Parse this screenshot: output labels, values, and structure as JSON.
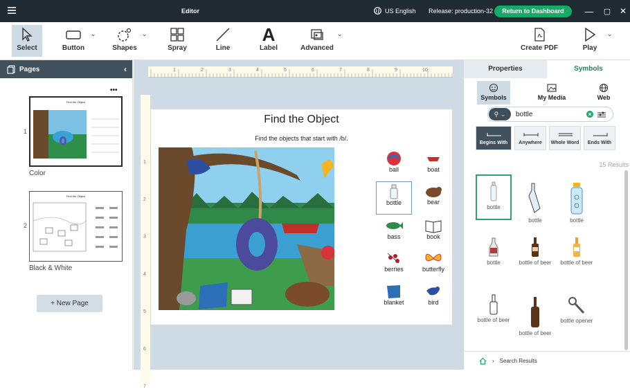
{
  "window": {
    "title": "Editor",
    "language": "US English",
    "release": "Release: production-32",
    "dashboard_button": "Return to Dashboard",
    "minimize": "—",
    "maximize": "▢",
    "close": "✕"
  },
  "toolbar": {
    "tools": [
      {
        "label": "Select",
        "icon": "cursor-icon"
      },
      {
        "label": "Button",
        "icon": "button-icon"
      },
      {
        "label": "Shapes",
        "icon": "shapes-icon"
      },
      {
        "label": "Spray",
        "icon": "spray-icon"
      },
      {
        "label": "Line",
        "icon": "line-icon"
      },
      {
        "label": "Label",
        "icon": "label-icon"
      },
      {
        "label": "Advanced",
        "icon": "advanced-icon"
      },
      {
        "label": "Create PDF",
        "icon": "pdf-icon"
      },
      {
        "label": "Play",
        "icon": "play-icon"
      }
    ]
  },
  "pages_panel": {
    "title": "Pages",
    "more": "•••",
    "pages": [
      {
        "number": "1",
        "label": "Color"
      },
      {
        "number": "2",
        "label": "Black & White"
      }
    ],
    "new_page": "+ New Page"
  },
  "ruler": {
    "marks": [
      "1",
      "2",
      "3",
      "4",
      "5",
      "6",
      "7",
      "8",
      "9",
      "10"
    ],
    "vmarks": [
      "1",
      "2",
      "3",
      "4",
      "5",
      "6",
      "7"
    ]
  },
  "page": {
    "title": "Find the Object",
    "subtitle": "Find the objects that start with /b/.",
    "objects": [
      "ball",
      "boat",
      "bottle",
      "bear",
      "bass",
      "book",
      "berries",
      "butterfly",
      "blanket",
      "bird"
    ]
  },
  "right_panel": {
    "tabs": {
      "properties": "Properties",
      "symbols": "Symbols"
    },
    "sources": {
      "symbols": "Symbols",
      "my_media": "My Media",
      "web": "Web"
    },
    "search_value": "bottle",
    "modes": [
      "Begins With",
      "Anywhere",
      "Whole Word",
      "Ends With"
    ],
    "results_count": "15 Results",
    "results": [
      "bottle",
      "bottle",
      "bottle",
      "bottle",
      "bottle of beer",
      "bottle of beer",
      "bottle of beer",
      "bottle of beer",
      "bottle opener"
    ],
    "breadcrumb": "Search Results"
  },
  "colors": {
    "titlebar": "#1f2a33",
    "accent_green": "#17a968",
    "panel_dark": "#40505c",
    "canvas_bg": "#cfdbe4"
  }
}
